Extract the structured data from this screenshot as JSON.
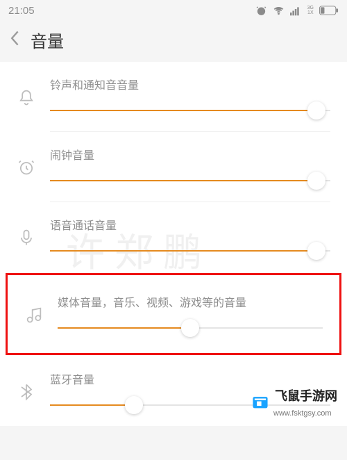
{
  "statusbar": {
    "time": "21:05",
    "network_label_top": "3G",
    "network_label_bottom": "1X"
  },
  "header": {
    "title": "音量"
  },
  "sliders": [
    {
      "key": "ring",
      "label": "铃声和通知音音量",
      "icon": "bell-icon",
      "value_pct": 95
    },
    {
      "key": "alarm",
      "label": "闹钟音量",
      "icon": "alarm-icon",
      "value_pct": 95
    },
    {
      "key": "voice",
      "label": "语音通话音量",
      "icon": "mic-icon",
      "value_pct": 95
    },
    {
      "key": "media",
      "label": "媒体音量，音乐、视频、游戏等的音量",
      "icon": "music-icon",
      "value_pct": 50,
      "highlight": true
    },
    {
      "key": "bt",
      "label": "蓝牙音量",
      "icon": "bluetooth-icon",
      "value_pct": 30
    }
  ],
  "watermark": "许郑鹏",
  "footer": {
    "site_name": "飞鼠手游网",
    "site_domain": "www.fsktgsy.com"
  }
}
